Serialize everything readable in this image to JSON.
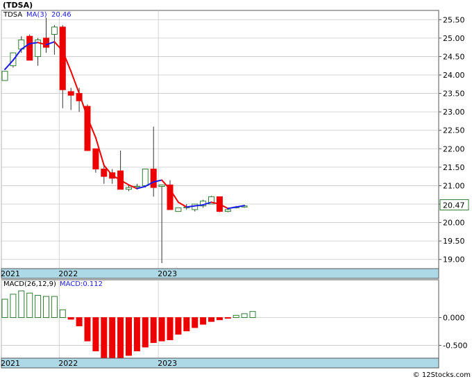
{
  "chart_title": "(TDSA)",
  "watermark": "© 12Stocks.com",
  "colors": {
    "up_candle": "#2e7d32",
    "down_candle": "#ee0000",
    "ma_up": "#1a1aee",
    "ma_down": "#ee0000",
    "axis_band": "#add8e6",
    "grid": "#c8c8c8",
    "macd_up": "#2e7d32",
    "macd_down": "#ee0000"
  },
  "chart_data": [
    {
      "type": "candlestick",
      "legend": {
        "symbol": "TDSA",
        "ma_label": "MA(3)",
        "ma_value": "20.46"
      },
      "last_price_label": "20.47",
      "ylim": [
        18.75,
        25.75
      ],
      "y_ticks": [
        "25.50",
        "25.00",
        "24.50",
        "24.00",
        "23.50",
        "23.00",
        "22.50",
        "22.00",
        "21.50",
        "21.00",
        "20.50",
        "20.00",
        "19.50",
        "19.00"
      ],
      "x_labels": [
        {
          "label": "2021",
          "index": 0
        },
        {
          "label": "2022",
          "index": 7
        },
        {
          "label": "2023",
          "index": 19
        }
      ],
      "candles": [
        {
          "open": 23.85,
          "high": 24.1,
          "low": 23.85,
          "close": 24.1
        },
        {
          "open": 24.25,
          "high": 24.6,
          "low": 24.2,
          "close": 24.6
        },
        {
          "open": 24.7,
          "high": 25.05,
          "low": 24.6,
          "close": 24.95
        },
        {
          "open": 25.05,
          "high": 25.1,
          "low": 24.4,
          "close": 24.4
        },
        {
          "open": 24.5,
          "high": 25.0,
          "low": 24.25,
          "close": 24.95
        },
        {
          "open": 25.0,
          "high": 25.55,
          "low": 24.6,
          "close": 24.75
        },
        {
          "open": 25.1,
          "high": 25.35,
          "low": 24.55,
          "close": 25.3
        },
        {
          "open": 25.3,
          "high": 25.35,
          "low": 23.1,
          "close": 23.6
        },
        {
          "open": 23.55,
          "high": 23.65,
          "low": 23.05,
          "close": 23.45
        },
        {
          "open": 23.5,
          "high": 23.65,
          "low": 23.0,
          "close": 23.3
        },
        {
          "open": 23.15,
          "high": 23.2,
          "low": 21.95,
          "close": 21.95
        },
        {
          "open": 22.0,
          "high": 22.0,
          "low": 21.35,
          "close": 21.45
        },
        {
          "open": 21.45,
          "high": 21.6,
          "low": 21.05,
          "close": 21.25
        },
        {
          "open": 21.35,
          "high": 21.45,
          "low": 21.05,
          "close": 21.2
        },
        {
          "open": 21.4,
          "high": 21.95,
          "low": 20.9,
          "close": 20.9
        },
        {
          "open": 20.9,
          "high": 21.0,
          "low": 20.85,
          "close": 20.95
        },
        {
          "open": 20.95,
          "high": 21.05,
          "low": 20.95,
          "close": 20.98
        },
        {
          "open": 21.0,
          "high": 21.45,
          "low": 20.95,
          "close": 21.45
        },
        {
          "open": 21.45,
          "high": 22.6,
          "low": 20.7,
          "close": 20.95
        },
        {
          "open": 20.98,
          "high": 20.98,
          "low": 18.9,
          "close": 21.02
        },
        {
          "open": 21.02,
          "high": 21.15,
          "low": 20.35,
          "close": 20.35
        },
        {
          "open": 20.3,
          "high": 20.4,
          "low": 20.3,
          "close": 20.4
        },
        {
          "open": 20.4,
          "high": 20.5,
          "low": 20.35,
          "close": 20.42
        },
        {
          "open": 20.35,
          "high": 20.5,
          "low": 20.3,
          "close": 20.5
        },
        {
          "open": 20.45,
          "high": 20.62,
          "low": 20.4,
          "close": 20.58
        },
        {
          "open": 20.5,
          "high": 20.72,
          "low": 20.5,
          "close": 20.7
        },
        {
          "open": 20.7,
          "high": 20.7,
          "low": 20.28,
          "close": 20.3
        },
        {
          "open": 20.3,
          "high": 20.35,
          "low": 20.28,
          "close": 20.35
        },
        {
          "open": 20.4,
          "high": 20.45,
          "low": 20.38,
          "close": 20.42
        },
        {
          "open": 20.42,
          "high": 20.47,
          "low": 20.4,
          "close": 20.45
        }
      ],
      "ma": [
        24.15,
        24.4,
        24.7,
        24.85,
        24.88,
        24.82,
        24.9,
        24.65,
        24.1,
        23.5,
        22.85,
        22.3,
        21.55,
        21.28,
        21.15,
        21.02,
        20.92,
        20.98,
        21.1,
        21.15,
        20.9,
        20.55,
        20.42,
        20.45,
        20.48,
        20.55,
        20.5,
        20.38,
        20.42,
        20.46
      ]
    },
    {
      "type": "bar",
      "legend": {
        "label": "MACD(26,12,9)",
        "value_label": "MACD:0.112"
      },
      "ylim": [
        -0.73,
        0.68
      ],
      "y_ticks": [
        "0.000",
        "-0.500"
      ],
      "x_labels": [
        {
          "label": "2021",
          "index": 0
        },
        {
          "label": "2022",
          "index": 7
        },
        {
          "label": "2023",
          "index": 19
        }
      ],
      "values": [
        0.33,
        0.42,
        0.48,
        0.44,
        0.4,
        0.38,
        0.38,
        0.14,
        -0.03,
        -0.15,
        -0.42,
        -0.6,
        -0.72,
        -0.74,
        -0.73,
        -0.68,
        -0.6,
        -0.53,
        -0.45,
        -0.42,
        -0.4,
        -0.3,
        -0.24,
        -0.18,
        -0.12,
        -0.07,
        -0.04,
        -0.01,
        0.04,
        0.07,
        0.11
      ]
    }
  ]
}
